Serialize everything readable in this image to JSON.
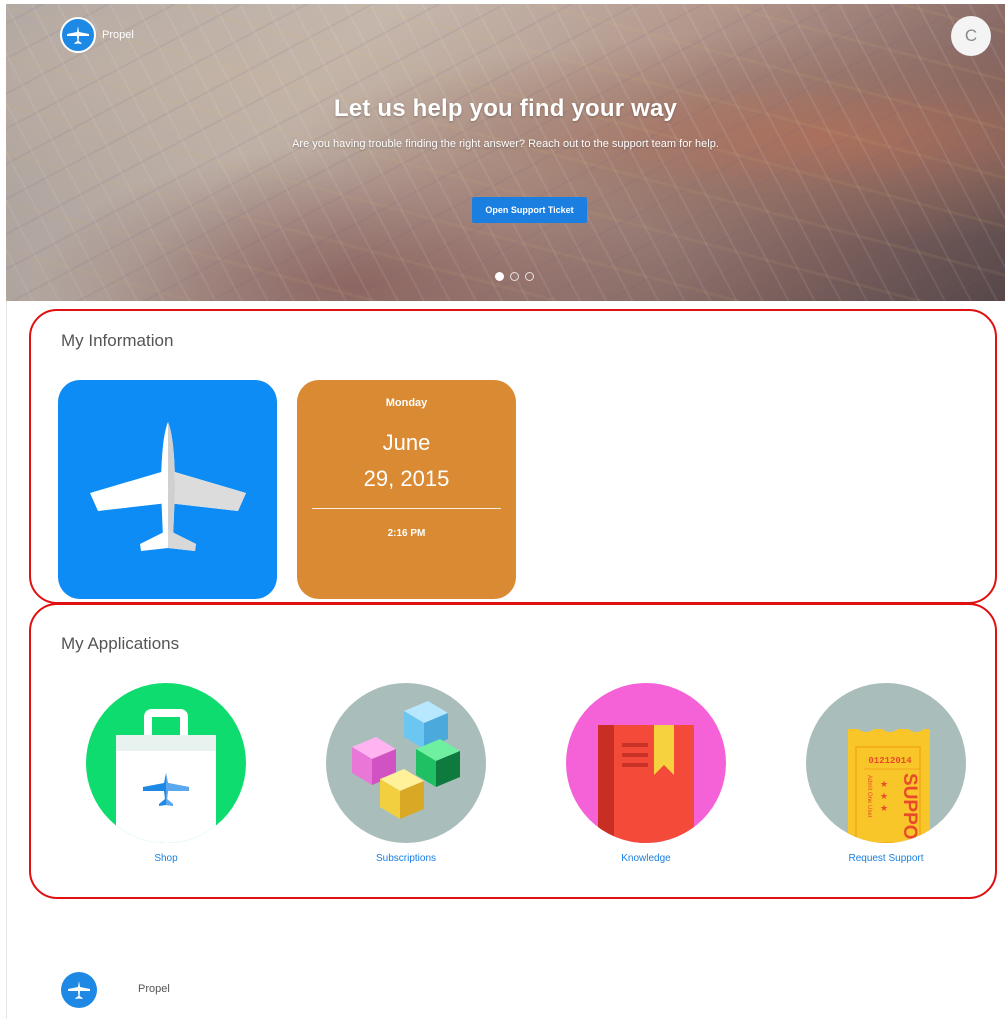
{
  "header": {
    "brand": "Propel",
    "avatar_initial": "C"
  },
  "hero": {
    "title": "Let us help you find your way",
    "subtitle": "Are you having trouble finding the right answer? Reach out to the support team for help.",
    "button_label": "Open Support Ticket",
    "carousel_dots": 3,
    "active_dot": 1
  },
  "my_information": {
    "title": "My Information",
    "date_tile": {
      "day": "Monday",
      "month": "June",
      "date": "29, 2015",
      "time": "2:16 PM"
    },
    "colors": {
      "plane_tile": "#0e8cf5",
      "date_tile": "#d98a32"
    }
  },
  "my_applications": {
    "title": "My Applications",
    "apps": [
      {
        "label": "Shop",
        "icon": "shopping-bag-icon",
        "color": "#0fdc6e"
      },
      {
        "label": "Subscriptions",
        "icon": "cubes-icon",
        "color": "#a9bdbb"
      },
      {
        "label": "Knowledge",
        "icon": "book-icon",
        "color": "#f562d8"
      },
      {
        "label": "Request Support",
        "icon": "ticket-icon",
        "color": "#a9bdbb",
        "ticket_number": "01212014",
        "ticket_text": "SUPPO",
        "ticket_small": "Admit One User"
      }
    ]
  },
  "footer": {
    "brand": "Propel"
  }
}
